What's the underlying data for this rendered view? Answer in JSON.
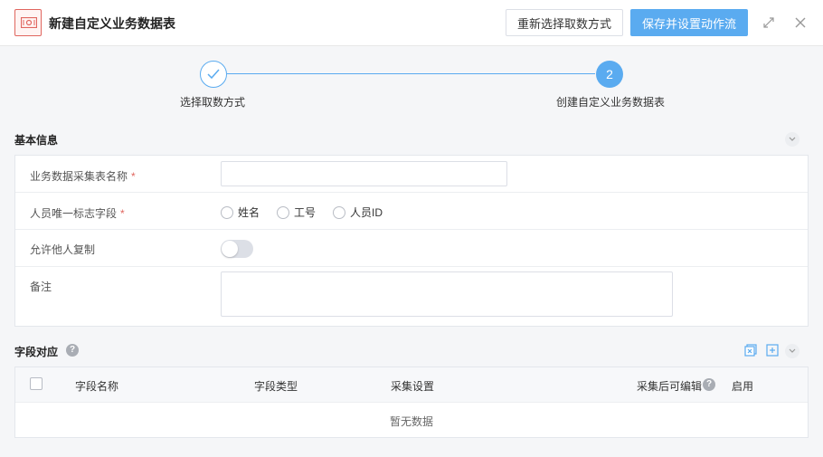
{
  "header": {
    "title": "新建自定义业务数据表",
    "reselect_label": "重新选择取数方式",
    "save_label": "保存并设置动作流"
  },
  "steps": [
    {
      "label": "选择取数方式",
      "status": "done"
    },
    {
      "label": "创建自定义业务数据表",
      "number": "2",
      "status": "active"
    }
  ],
  "basic_info": {
    "title": "基本信息",
    "fields": {
      "table_name_label": "业务数据采集表名称",
      "table_name_value": "",
      "id_field_label": "人员唯一标志字段",
      "id_options": [
        "姓名",
        "工号",
        "人员ID"
      ],
      "allow_copy_label": "允许他人复制",
      "allow_copy_on": false,
      "remark_label": "备注",
      "remark_value": ""
    },
    "required_mark": "*"
  },
  "field_mapping": {
    "title": "字段对应",
    "help": "?",
    "columns": [
      "字段名称",
      "字段类型",
      "采集设置",
      "采集后可编辑",
      "启用"
    ],
    "empty_text": "暂无数据"
  },
  "colors": {
    "primary": "#5aabf0",
    "required": "#e0665f",
    "icon_border": "#e0665f"
  },
  "icons": {
    "app": "money-bill-icon",
    "expand": "expand-icon",
    "close": "close-icon",
    "step_done": "check-icon",
    "collapse": "chevron-down-icon",
    "help": "question-icon",
    "import": "import-icon",
    "add": "add-icon"
  }
}
